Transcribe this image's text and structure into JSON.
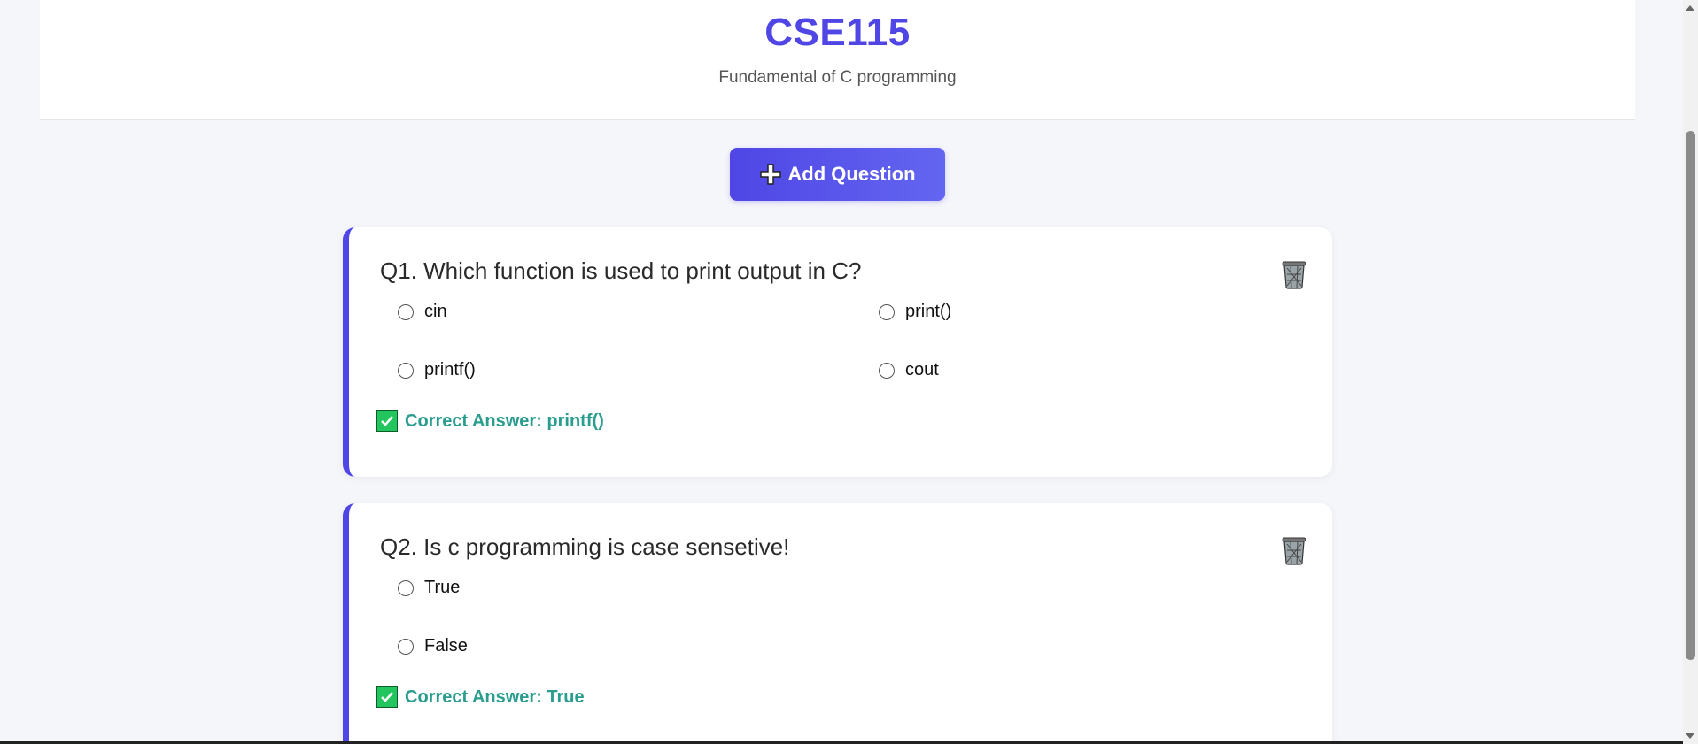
{
  "header": {
    "title": "CSE115",
    "subtitle": "Fundamental of C programming"
  },
  "toolbar": {
    "add_question_label": "Add Question"
  },
  "questions": [
    {
      "text": "Q1. Which function is used to print output in C?",
      "options": [
        "cin",
        "print()",
        "printf()",
        "cout"
      ],
      "correct_answer": "Correct Answer: printf()"
    },
    {
      "text": "Q2. Is c programming is case sensetive!",
      "options": [
        "True",
        "False"
      ],
      "correct_answer": "Correct Answer: True"
    }
  ],
  "icons": {
    "add": "plus-icon",
    "delete": "trash-icon",
    "correct": "checkmark-icon"
  },
  "colors": {
    "accent": "#4f46e5",
    "answer": "#2a9d8f",
    "check": "#22c55e",
    "background": "#f5f6fa"
  }
}
